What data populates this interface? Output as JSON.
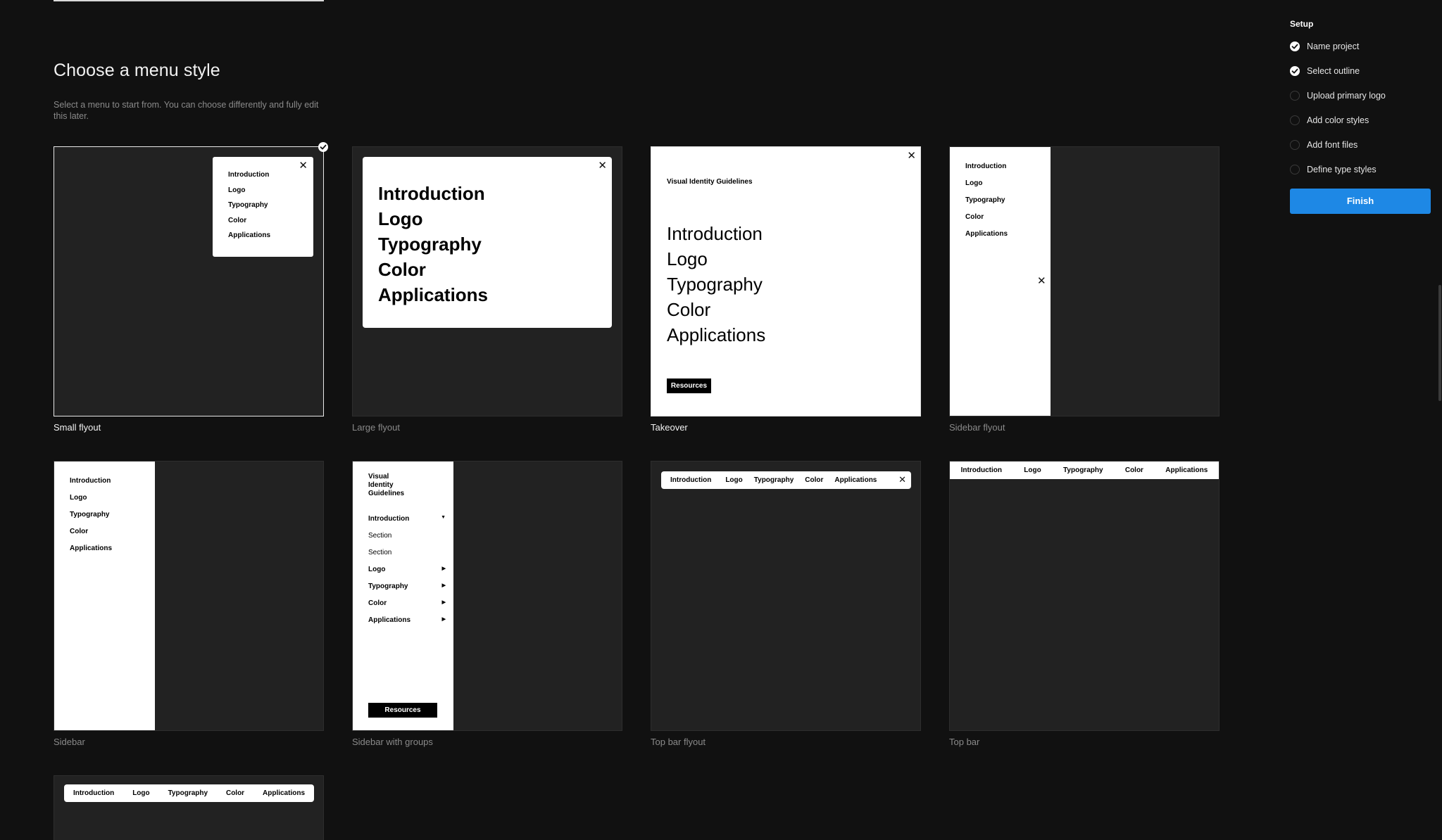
{
  "page": {
    "heading": "Choose a menu style",
    "subtitle": "Select a menu to start from. You can choose differently and fully edit this later."
  },
  "menu_items": [
    "Introduction",
    "Logo",
    "Typography",
    "Color",
    "Applications"
  ],
  "brand": "Visual Identity Guidelines",
  "brand_lines": [
    "Visual",
    "Identity",
    "Guidelines"
  ],
  "resources_label": "Resources",
  "section_label": "Section",
  "cards": [
    {
      "label": "Small flyout",
      "selected": true
    },
    {
      "label": "Large flyout",
      "selected": false
    },
    {
      "label": "Takeover",
      "selected": false
    },
    {
      "label": "Sidebar flyout",
      "selected": false
    },
    {
      "label": "Sidebar",
      "selected": false
    },
    {
      "label": "Sidebar with groups",
      "selected": false
    },
    {
      "label": "Top bar flyout",
      "selected": false
    },
    {
      "label": "Top bar",
      "selected": false
    }
  ],
  "setup": {
    "title": "Setup",
    "steps": [
      {
        "label": "Name project",
        "done": true
      },
      {
        "label": "Select outline",
        "done": true
      },
      {
        "label": "Upload primary logo",
        "done": false
      },
      {
        "label": "Add color styles",
        "done": false
      },
      {
        "label": "Add font files",
        "done": false
      },
      {
        "label": "Define type styles",
        "done": false
      }
    ],
    "finish_label": "Finish"
  },
  "colors": {
    "background": "#111111",
    "card": "#222222",
    "accent": "#1e88e5"
  }
}
